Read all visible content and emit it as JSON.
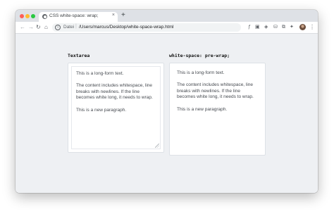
{
  "browser": {
    "tab_title": "CSS white-space: wrap;",
    "tab_close": "×",
    "new_tab": "+",
    "address_scheme": "Datei",
    "address_separator": "|",
    "address_path": "/Users/marcus/Desktop/white-space-wrap.html",
    "nav": {
      "back": "←",
      "forward": "→",
      "reload": "↻",
      "home": "⌂"
    },
    "extensions": [
      "ƒ",
      "▣",
      "◈",
      "⛁",
      "⧉",
      "✦"
    ],
    "menu": "⋮",
    "icons": {
      "site": "globe-icon",
      "info": "info-icon",
      "avatar": "avatar-icon"
    }
  },
  "page": {
    "left_column": {
      "title": "Textarea",
      "paragraphs": [
        "This is a long-form text.",
        "The content includes whitespace, line breaks with newlines. If the line becomes white long, it needs to wrap.",
        "This is a new paragraph."
      ]
    },
    "right_column": {
      "title": "white-space: pre-wrap;",
      "paragraphs": [
        "This is a long-form text.",
        "The content includes whitespace, line breaks with newlines. If the line becomes white long, it needs to wrap.",
        "This is a new paragraph."
      ]
    }
  },
  "colors": {
    "page_background": "#eef0f3",
    "card_background": "#ffffff",
    "text": "#474b51"
  }
}
